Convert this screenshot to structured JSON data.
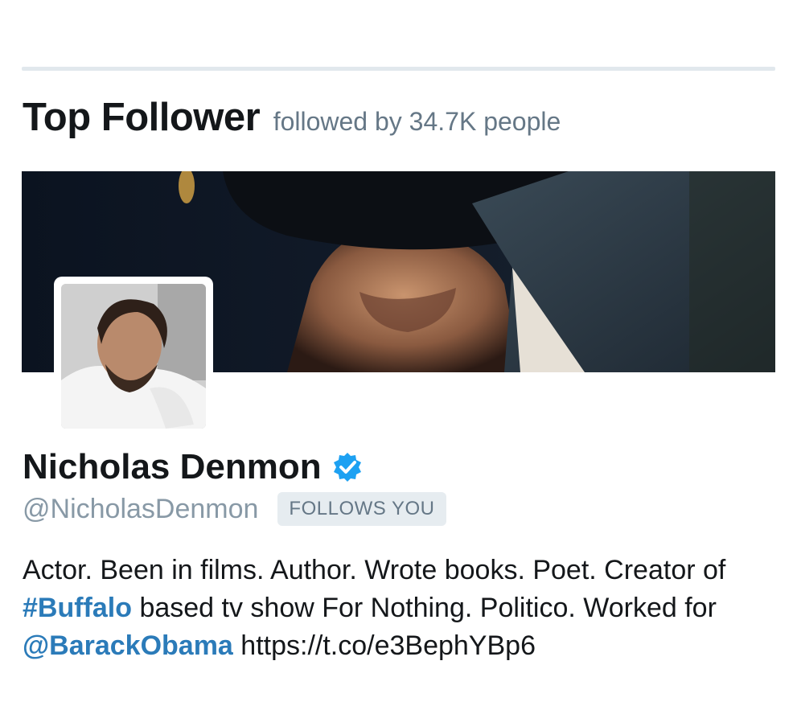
{
  "section": {
    "title": "Top Follower",
    "subtitle": "followed by 34.7K people"
  },
  "profile": {
    "name": "Nicholas Denmon",
    "verified": true,
    "handle": "@NicholasDenmon",
    "follows_badge": "FOLLOWS YOU",
    "bio": {
      "part1": "Actor. Been in films. Author. Wrote books. Poet. Creator of ",
      "hashtag": "#Buffalo",
      "part2": " based tv show For Nothing. Politico. Worked for ",
      "mention": "@BarackObama",
      "url": " https://t.co/e3BephYBp6"
    }
  },
  "colors": {
    "link": "#2b7bb9",
    "verified": "#1da1f2",
    "muted": "#657786"
  }
}
